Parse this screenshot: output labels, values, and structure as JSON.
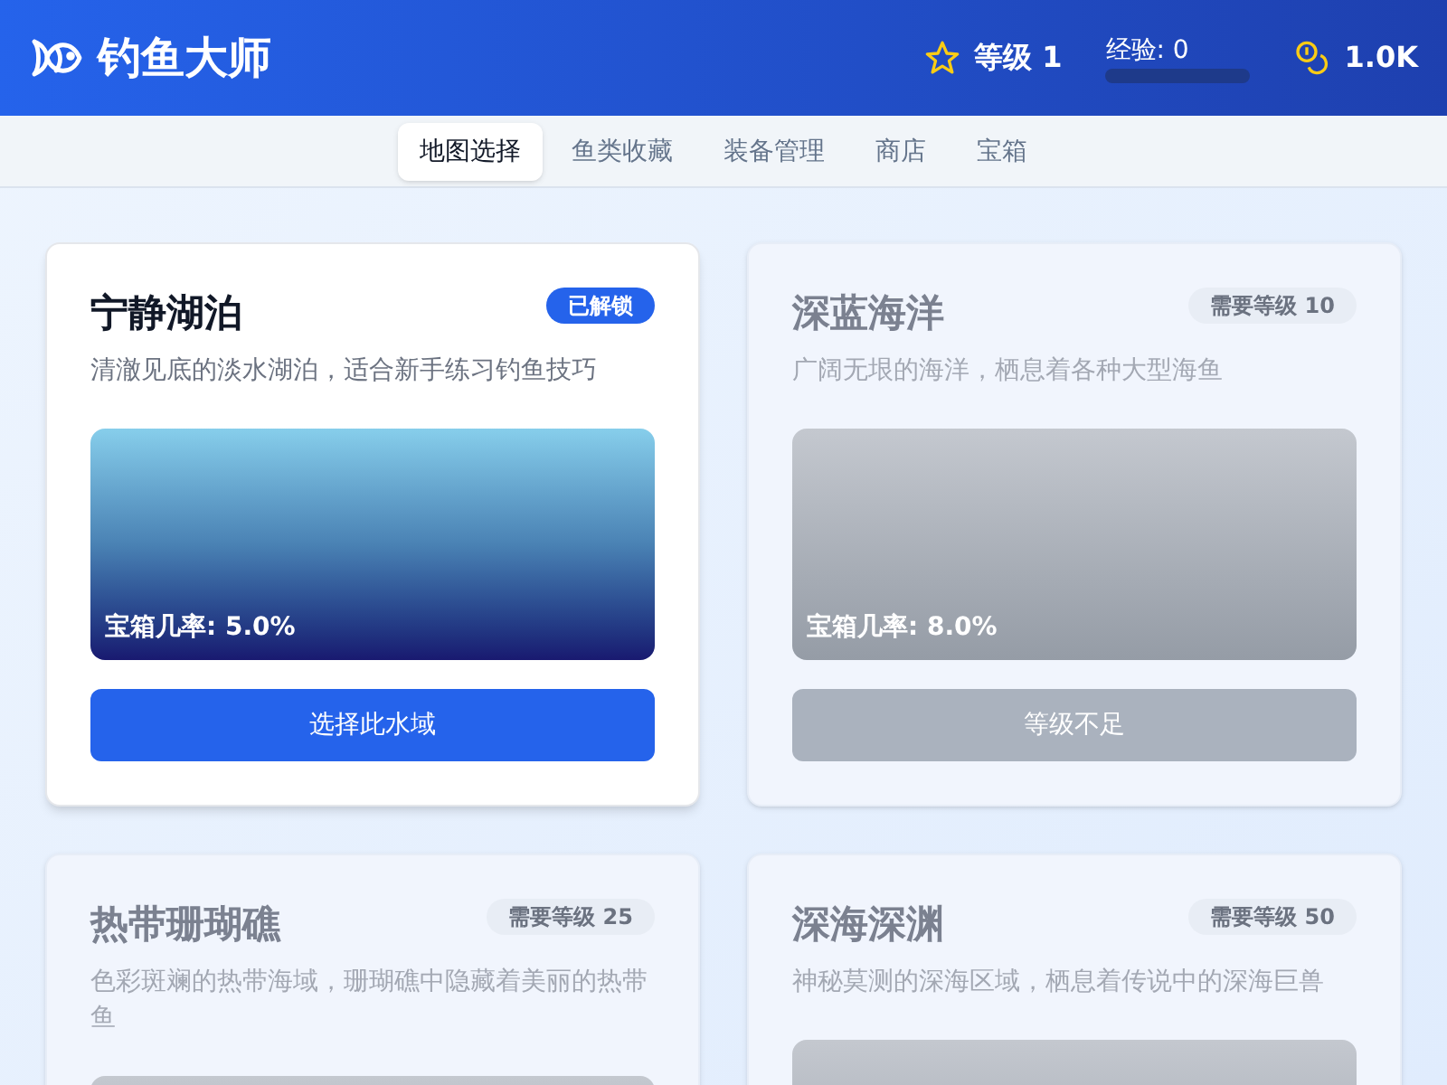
{
  "header": {
    "title": "钓鱼大师",
    "level": "等级 1",
    "exp_label": "经验: 0",
    "exp": {
      "level": 0
    },
    "coins": "1.0K"
  },
  "tabs": [
    {
      "label": "地图选择",
      "selected": true
    },
    {
      "label": "鱼类收藏",
      "selected": false
    },
    {
      "label": "装备管理",
      "selected": false
    },
    {
      "label": "商店",
      "selected": false
    },
    {
      "label": "宝箱",
      "selected": false
    }
  ],
  "maps": [
    {
      "name": "宁静湖泊",
      "unlocked": true,
      "badge": "已解锁",
      "description": "清澈见底的淡水湖泊，适合新手练习钓鱼技巧",
      "chest_rate": "宝箱几率: 5.0%",
      "button": "选择此水域"
    },
    {
      "name": "深蓝海洋",
      "unlocked": false,
      "badge": "需要等级 10",
      "description": "广阔无垠的海洋，栖息着各种大型海鱼",
      "chest_rate": "宝箱几率: 8.0%",
      "button": "等级不足"
    },
    {
      "name": "热带珊瑚礁",
      "unlocked": false,
      "badge": "需要等级 25",
      "description": "色彩斑斓的热带海域，珊瑚礁中隐藏着美丽的热带鱼"
    },
    {
      "name": "深海深渊",
      "unlocked": false,
      "badge": "需要等级 50",
      "description": "神秘莫测的深海区域，栖息着传说中的深海巨兽"
    }
  ]
}
